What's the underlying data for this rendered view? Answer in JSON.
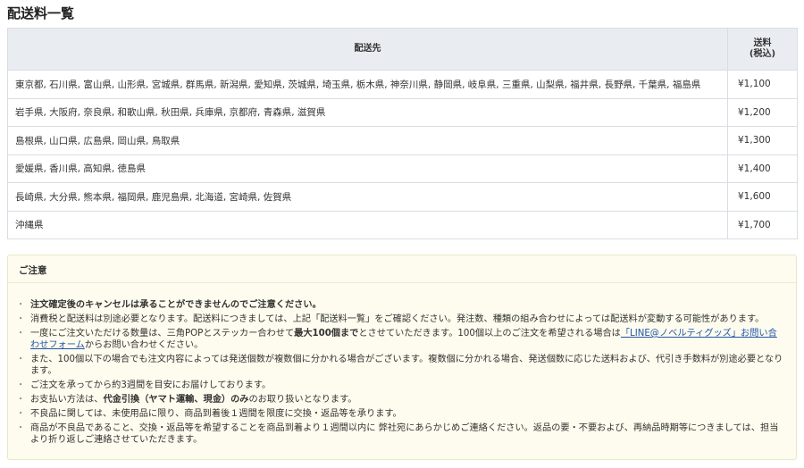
{
  "page": {
    "title": "配送料一覧"
  },
  "table": {
    "headers": {
      "region": "配送先",
      "price_line1": "送料",
      "price_line2": "(税込)"
    },
    "rows": [
      {
        "region": "東京都, 石川県, 富山県, 山形県, 宮城県, 群馬県, 新潟県, 愛知県, 茨城県, 埼玉県, 栃木県, 神奈川県, 静岡県, 岐阜県, 三重県, 山梨県, 福井県, 長野県, 千葉県, 福島県",
        "price": "¥1,100"
      },
      {
        "region": "岩手県, 大阪府, 奈良県, 和歌山県, 秋田県, 兵庫県, 京都府, 青森県, 滋賀県",
        "price": "¥1,200"
      },
      {
        "region": "島根県, 山口県, 広島県, 岡山県, 鳥取県",
        "price": "¥1,300"
      },
      {
        "region": "愛媛県, 香川県, 高知県, 徳島県",
        "price": "¥1,400"
      },
      {
        "region": "長崎県, 大分県, 熊本県, 福岡県, 鹿児島県, 北海道, 宮崎県, 佐賀県",
        "price": "¥1,600"
      },
      {
        "region": "沖縄県",
        "price": "¥1,700"
      }
    ]
  },
  "notice": {
    "title": "ご注意",
    "items": {
      "i1": "注文確定後のキャンセルは承ることができませんのでご注意ください。",
      "i2": "消費税と配送料は別途必要となります。配送料につきましては、上記「配送料一覧」をご確認ください。発注数、種類の組み合わせによっては配送料が変動する可能性があります。",
      "i3_a": "一度にご注文いただける数量は、三角POPとステッカー合わせて",
      "i3_b": "最大100個まで",
      "i3_c": "とさせていただきます。100個以上のご注文を希望される場合は",
      "i3_link": "「LINE@ノベルティグッズ」お問い合わせフォーム",
      "i3_d": "からお問い合わせください。",
      "i4": "また、100個以下の場合でも注文内容によっては発送個数が複数個に分かれる場合がございます。複数個に分かれる場合、発送個数に応じた送料および、代引き手数料が別途必要となります。",
      "i5": "ご注文を承ってから約3週間を目安にお届けしております。",
      "i6_a": "お支払い方法は、",
      "i6_b": "代金引換（ヤマト運輸、現金）のみ",
      "i6_c": "のお取り扱いとなります。",
      "i7": "不良品に関しては、未使用品に限り、商品到着後１週間を限度に交換・返品等を承ります。",
      "i8": "商品が不良品であること、交換・返品等を希望することを商品到着より１週間以内に 弊社宛にあらかじめご連絡ください。返品の要・不要および、再納品時期等につきましては、担当より折り返しご連絡させていただきます。"
    }
  }
}
